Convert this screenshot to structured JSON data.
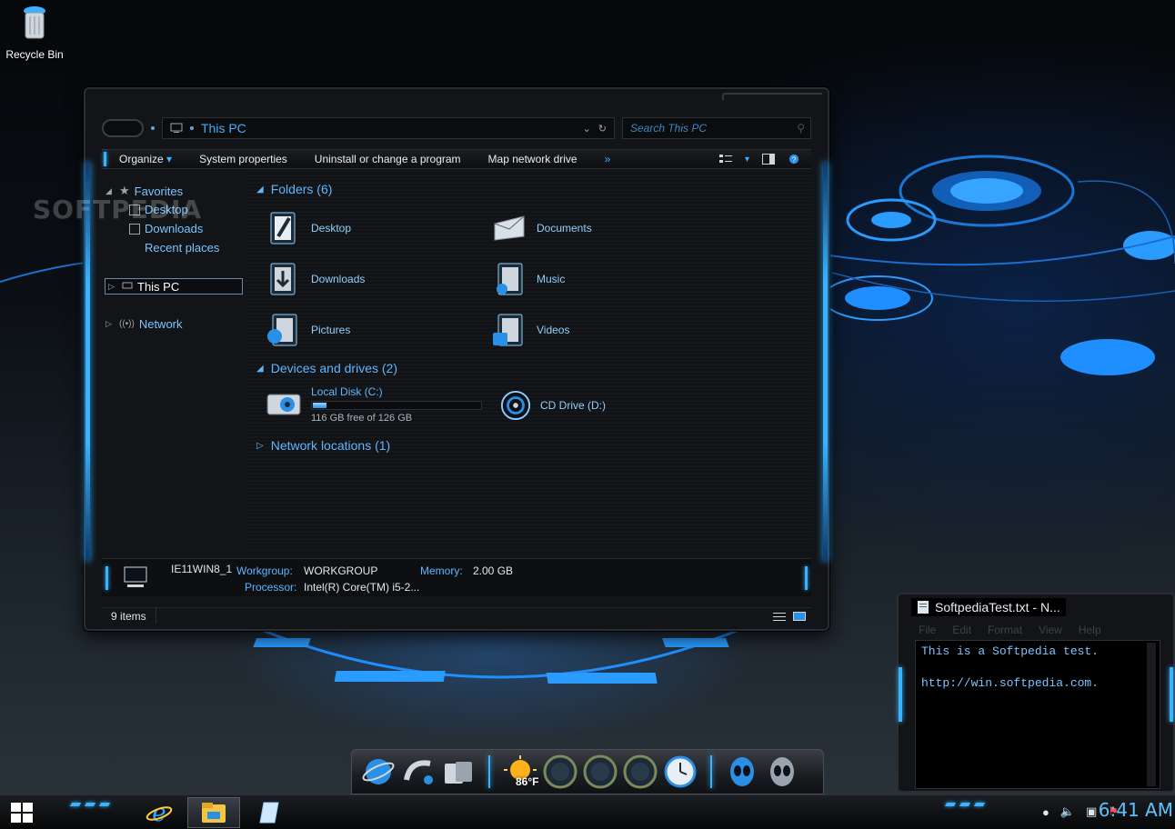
{
  "desktop": {
    "recycle_bin_label": "Recycle Bin",
    "watermark": "SOFTPEDIA"
  },
  "explorer": {
    "address_path": "This PC",
    "search_placeholder": "Search This PC",
    "command_bar": {
      "organize": "Organize",
      "system_properties": "System properties",
      "uninstall": "Uninstall or change a program",
      "map_drive": "Map network drive",
      "more": "»"
    },
    "nav": {
      "favorites": "Favorites",
      "desktop": "Desktop",
      "downloads": "Downloads",
      "recent": "Recent places",
      "this_pc": "This PC",
      "network": "Network"
    },
    "folders_header": "Folders (6)",
    "folders": [
      {
        "label": "Desktop",
        "icon": "desktop-folder-icon"
      },
      {
        "label": "Documents",
        "icon": "documents-folder-icon"
      },
      {
        "label": "Downloads",
        "icon": "downloads-folder-icon"
      },
      {
        "label": "Music",
        "icon": "music-folder-icon"
      },
      {
        "label": "Pictures",
        "icon": "pictures-folder-icon"
      },
      {
        "label": "Videos",
        "icon": "videos-folder-icon"
      }
    ],
    "devices_header": "Devices and drives (2)",
    "local_disk": {
      "name": "Local Disk (C:)",
      "free_text": "116 GB free of 126 GB",
      "used_fraction": 0.08
    },
    "cd_drive": "CD Drive (D:)",
    "network_header": "Network locations (1)",
    "details": {
      "computer_name": "IE11WIN8_1",
      "workgroup_key": "Workgroup:",
      "workgroup_val": "WORKGROUP",
      "memory_key": "Memory:",
      "memory_val": "2.00 GB",
      "processor_key": "Processor:",
      "processor_val": "Intel(R) Core(TM) i5-2..."
    },
    "status_count": "9 items"
  },
  "notepad": {
    "title": "SoftpediaTest.txt - N...",
    "menu": [
      "File",
      "Edit",
      "Format",
      "View",
      "Help"
    ],
    "lines": [
      "This is a Softpedia test.",
      "",
      "",
      "http://win.softpedia.com."
    ]
  },
  "dock": {
    "temperature": "86°F"
  },
  "taskbar": {
    "clock": "6:41 AM"
  },
  "colors": {
    "accent": "#39b3ff",
    "link_text": "#5fb6ff",
    "window_bg": "#121417"
  }
}
